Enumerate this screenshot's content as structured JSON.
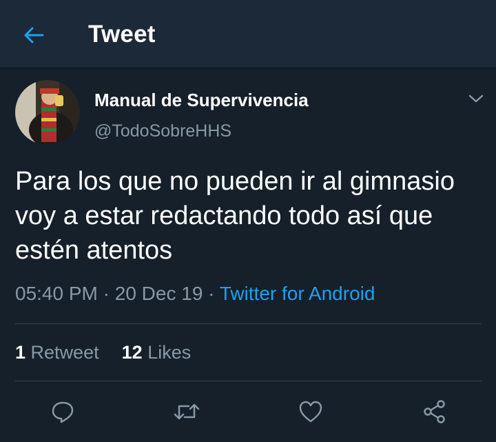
{
  "header": {
    "title": "Tweet",
    "back_icon": "arrow-left-icon",
    "accent": "#1da1f2"
  },
  "tweet": {
    "display_name": "Manual de Supervivencia",
    "handle": "@TodoSobreHHS",
    "text": "Para los que no pueden ir al gimnasio voy a estar redactando todo así que estén atentos",
    "time": "05:40 PM",
    "sep1": " · ",
    "date": "20 Dec 19",
    "sep2": " · ",
    "source": "Twitter for Android"
  },
  "stats": {
    "retweets_count": "1",
    "retweets_label": "Retweet",
    "likes_count": "12",
    "likes_label": "Likes"
  },
  "actions": [
    "reply-icon",
    "retweet-icon",
    "like-icon",
    "share-icon"
  ],
  "colors": {
    "background": "#15202b",
    "header_bg": "#1c2938",
    "secondary_text": "#8899a6",
    "link": "#1da1f2",
    "divider": "#38444d"
  }
}
